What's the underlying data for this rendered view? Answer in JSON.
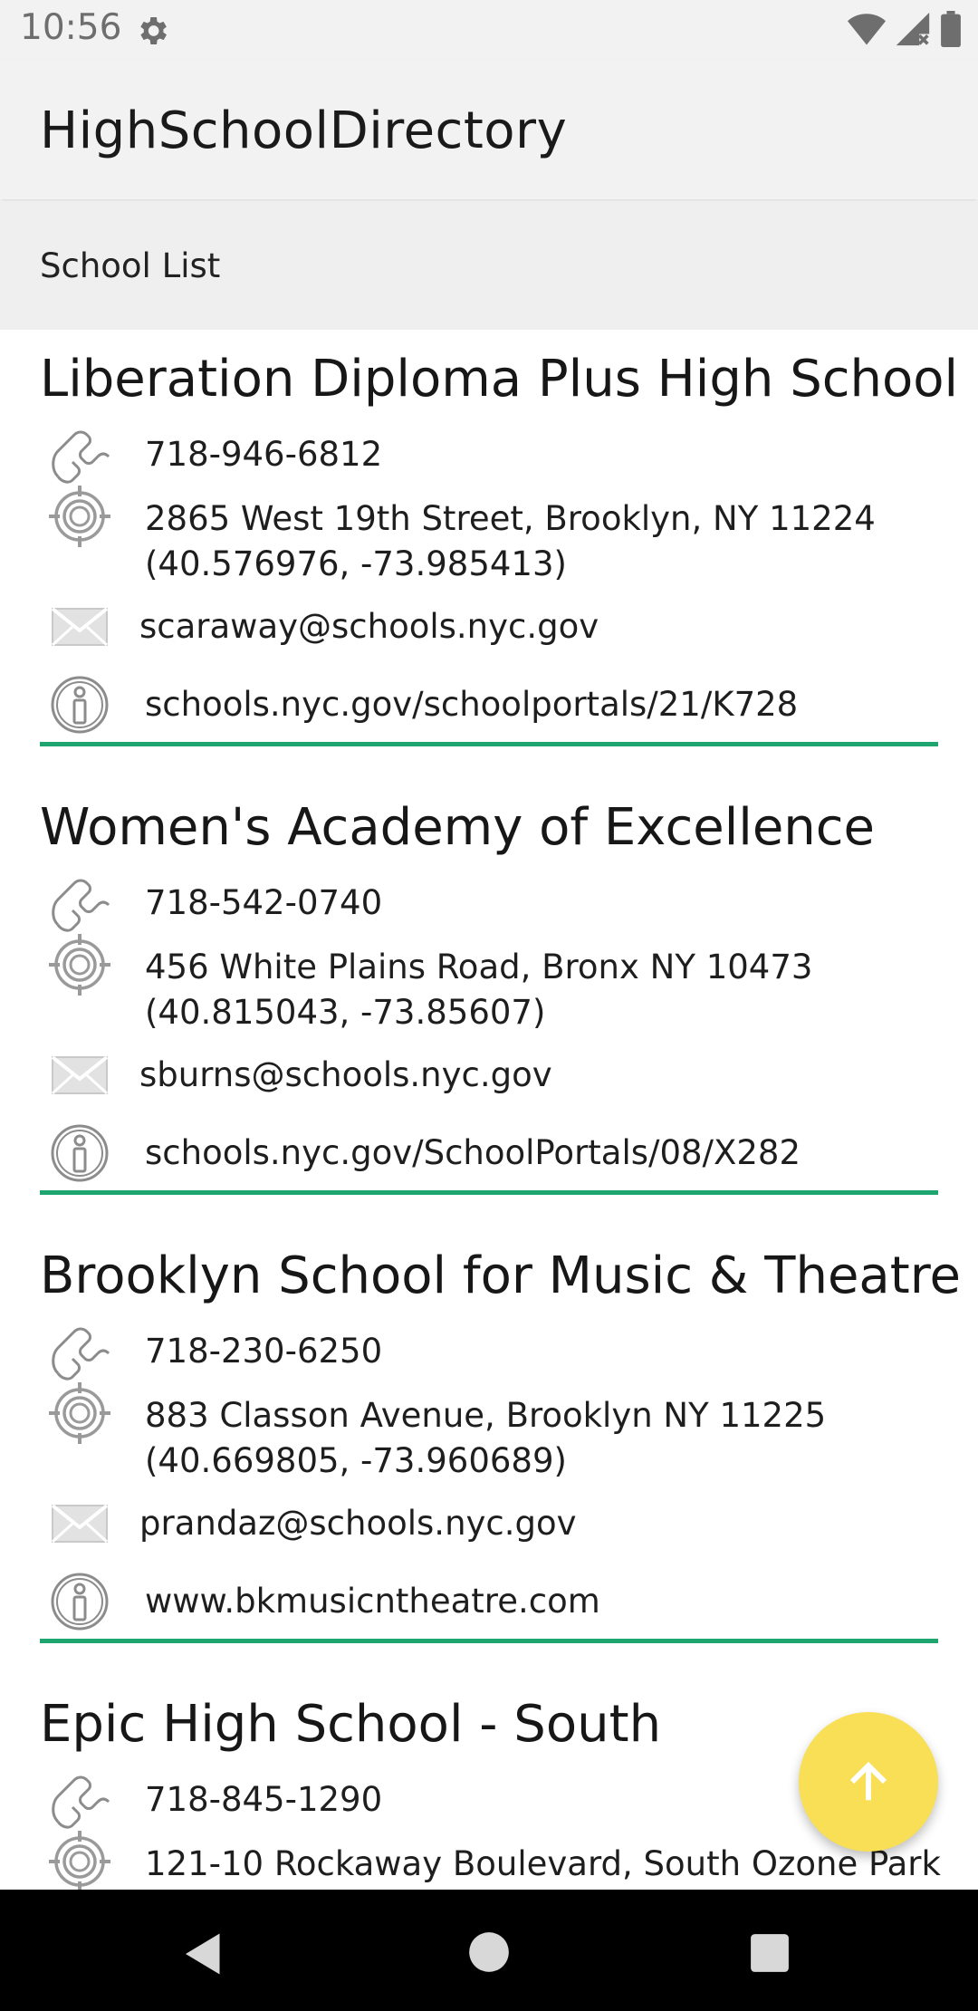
{
  "status_bar": {
    "time": "10:56",
    "icons": [
      "gear-icon",
      "wifi-icon",
      "signal-icon",
      "battery-icon"
    ]
  },
  "app_bar": {
    "title": "HighSchoolDirectory"
  },
  "section": {
    "label": "School List"
  },
  "schools": [
    {
      "name": "Liberation Diploma Plus High School",
      "phone": "718-946-6812",
      "address_line1": "2865 West 19th Street, Brooklyn, NY 11224",
      "address_line2": "(40.576976, -73.985413)",
      "email": "scaraway@schools.nyc.gov",
      "website": "schools.nyc.gov/schoolportals/21/K728"
    },
    {
      "name": "Women's Academy of Excellence",
      "phone": "718-542-0740",
      "address_line1": "456 White Plains Road, Bronx NY 10473",
      "address_line2": "(40.815043, -73.85607)",
      "email": "sburns@schools.nyc.gov",
      "website": "schools.nyc.gov/SchoolPortals/08/X282"
    },
    {
      "name": "Brooklyn School for Music & Theatre",
      "phone": "718-230-6250",
      "address_line1": "883 Classon Avenue, Brooklyn NY 11225",
      "address_line2": "(40.669805, -73.960689)",
      "email": "prandaz@schools.nyc.gov",
      "website": "www.bkmusicntheatre.com"
    },
    {
      "name": "Epic High School - South",
      "phone": "718-845-1290",
      "address_line1": "121-10 Rockaway Boulevard, South Ozone Park",
      "address_line2": "",
      "email": "",
      "website": ""
    }
  ],
  "fab": {
    "icon": "arrow-up-icon"
  },
  "nav_bar": {
    "icons": [
      "back-icon",
      "home-icon",
      "recents-icon"
    ]
  },
  "colors": {
    "divider": "#1fa56f",
    "fab": "#f8df56",
    "bars": "#f2f2f2",
    "nav": "#000000"
  }
}
